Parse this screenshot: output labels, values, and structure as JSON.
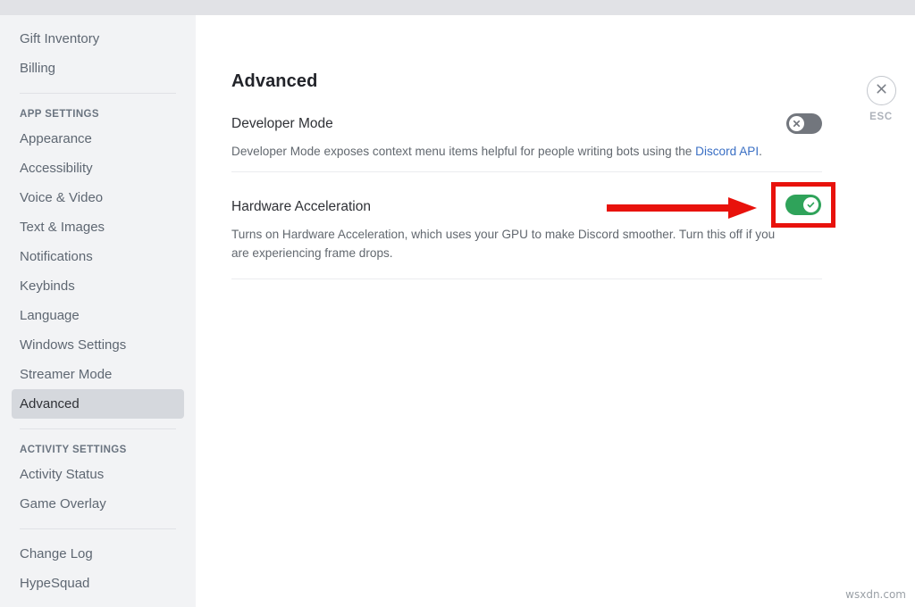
{
  "window": {
    "top_strip_color": "#e1e2e6",
    "sidebar_bg": "#f2f3f5",
    "accent_green": "#2fa35a",
    "annotation_red": "#e8120c",
    "link_blue": "#3a6fc4"
  },
  "sidebar": {
    "top_items": [
      {
        "label": "Gift Inventory",
        "selected": false
      },
      {
        "label": "Billing",
        "selected": false
      }
    ],
    "app_settings_header": "APP SETTINGS",
    "app_settings_items": [
      {
        "label": "Appearance",
        "selected": false
      },
      {
        "label": "Accessibility",
        "selected": false
      },
      {
        "label": "Voice & Video",
        "selected": false
      },
      {
        "label": "Text & Images",
        "selected": false
      },
      {
        "label": "Notifications",
        "selected": false
      },
      {
        "label": "Keybinds",
        "selected": false
      },
      {
        "label": "Language",
        "selected": false
      },
      {
        "label": "Windows Settings",
        "selected": false
      },
      {
        "label": "Streamer Mode",
        "selected": false
      },
      {
        "label": "Advanced",
        "selected": true
      }
    ],
    "activity_settings_header": "ACTIVITY SETTINGS",
    "activity_settings_items": [
      {
        "label": "Activity Status",
        "selected": false
      },
      {
        "label": "Game Overlay",
        "selected": false
      }
    ],
    "footer_items": [
      {
        "label": "Change Log",
        "selected": false
      },
      {
        "label": "HypeSquad",
        "selected": false
      }
    ]
  },
  "main": {
    "page_title": "Advanced",
    "settings": [
      {
        "label": "Developer Mode",
        "description_before_link": "Developer Mode exposes context menu items helpful for people writing bots using the ",
        "link_text": "Discord API",
        "description_after_link": ".",
        "toggle_state": "off",
        "toggle_icon": "close-icon"
      },
      {
        "label": "Hardware Acceleration",
        "description": "Turns on Hardware Acceleration, which uses your GPU to make Discord smoother. Turn this off if you are experiencing frame drops.",
        "toggle_state": "on",
        "toggle_icon": "check-icon",
        "highlighted": true
      }
    ]
  },
  "close": {
    "icon": "close-icon",
    "label": "ESC"
  },
  "watermark": {
    "text": "wsxdn.com"
  }
}
